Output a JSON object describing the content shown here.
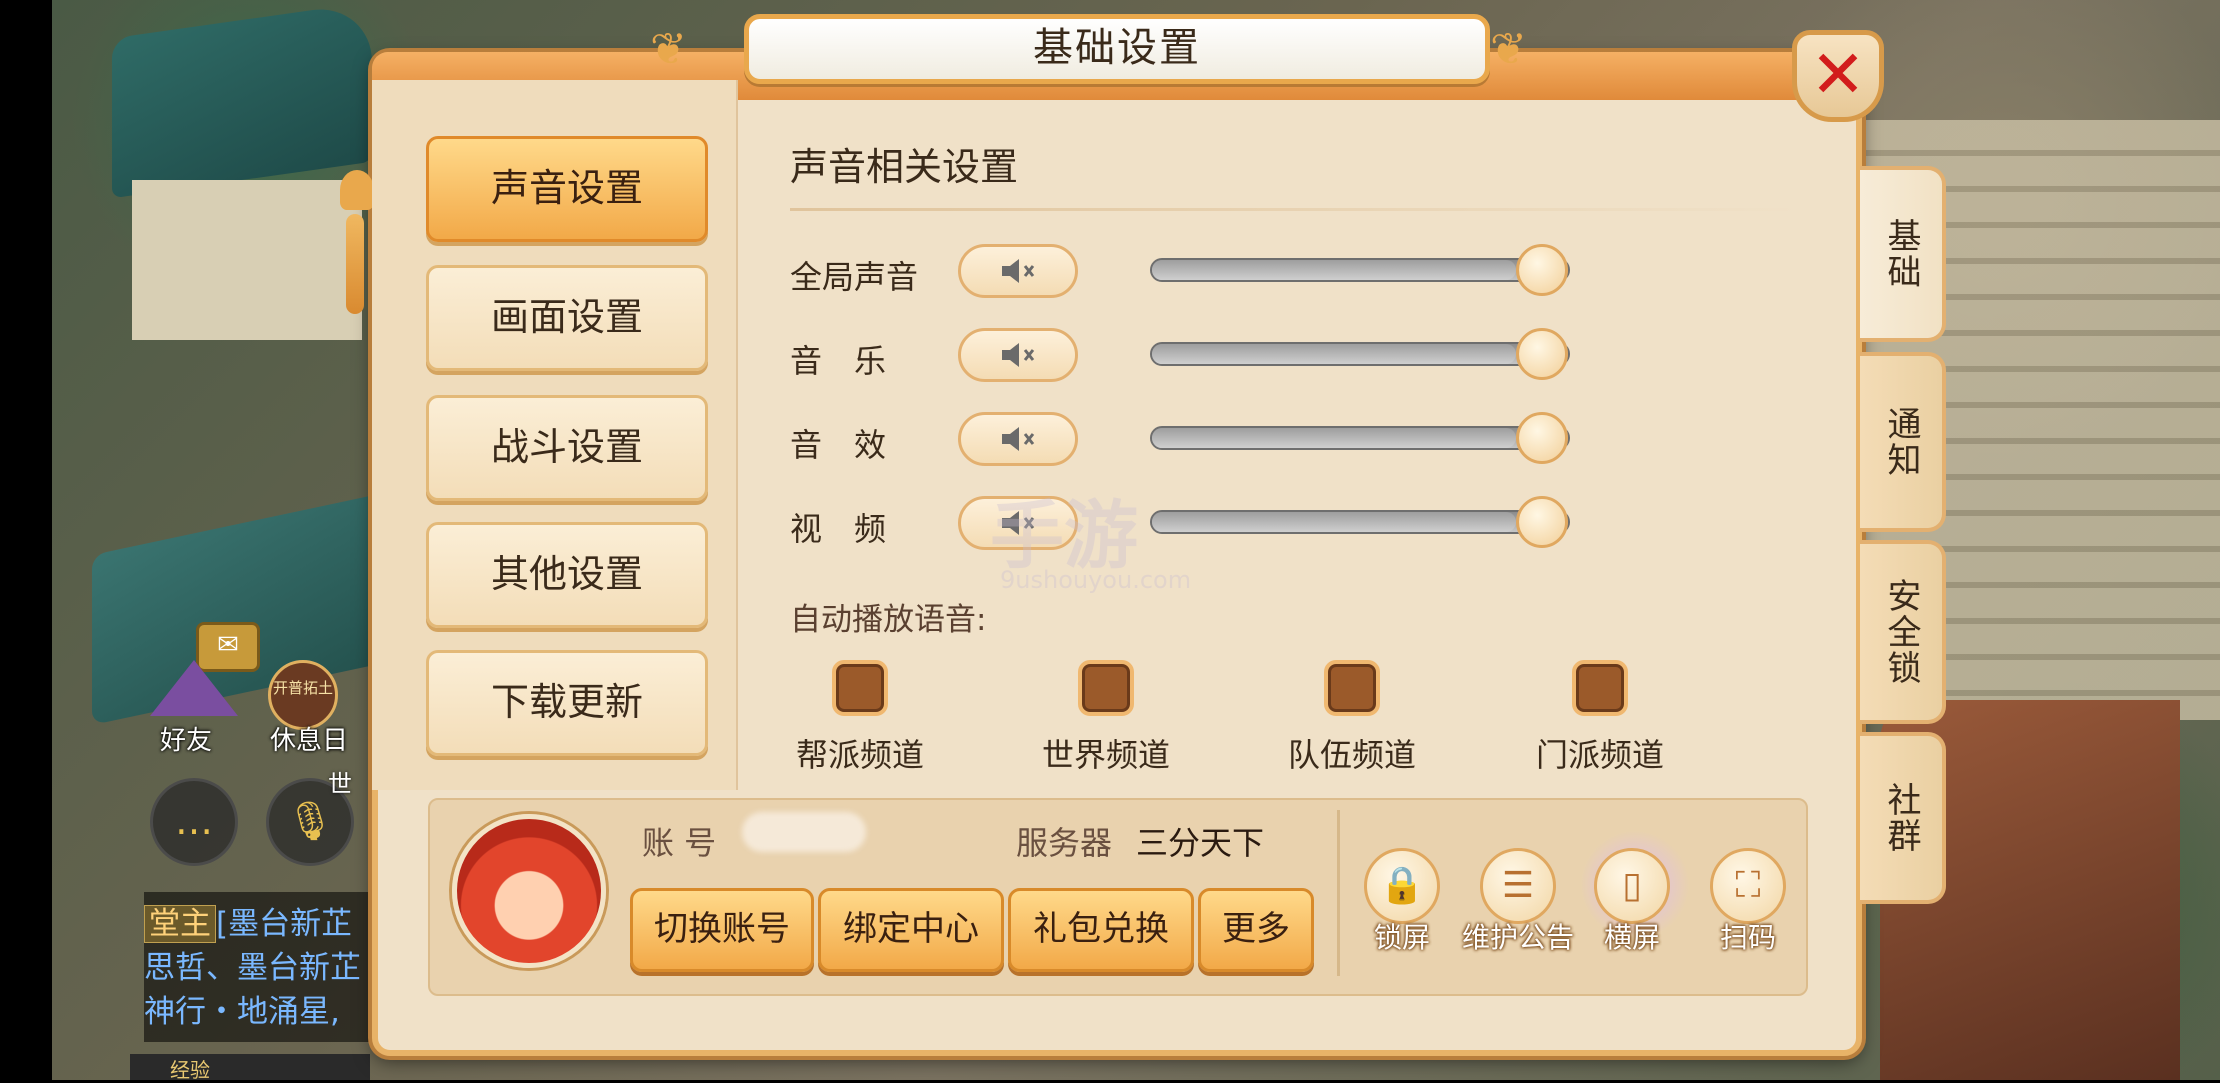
{
  "window": {
    "title": "基础设置",
    "close_icon": "close-icon"
  },
  "categories": [
    {
      "label": "声音设置",
      "active": true
    },
    {
      "label": "画面设置",
      "active": false
    },
    {
      "label": "战斗设置",
      "active": false
    },
    {
      "label": "其他设置",
      "active": false
    },
    {
      "label": "下载更新",
      "active": false
    }
  ],
  "side_tabs": [
    {
      "label": "基础",
      "active": true
    },
    {
      "label": "通知",
      "active": false
    },
    {
      "label": "安全锁",
      "active": false
    },
    {
      "label": "社群",
      "active": false
    }
  ],
  "sound": {
    "section_title": "声音相关设置",
    "controls": [
      {
        "label": "全局声音",
        "level": 1.0
      },
      {
        "label": "音　乐",
        "level": 1.0
      },
      {
        "label": "音　效",
        "level": 1.0
      },
      {
        "label": "视　频",
        "level": 1.0
      }
    ],
    "auto_play_label": "自动播放语音:",
    "channels": [
      "帮派频道",
      "世界频道",
      "队伍频道",
      "门派频道"
    ]
  },
  "account": {
    "account_label": "账 号",
    "server_label": "服务器",
    "server_value": "三分天下",
    "buttons": [
      "切换账号",
      "绑定中心",
      "礼包兑换",
      "更多"
    ],
    "tools": [
      {
        "label": "锁屏",
        "icon": "lock-icon"
      },
      {
        "label": "维护公告",
        "icon": "notice-board-icon"
      },
      {
        "label": "横屏",
        "icon": "rotate-screen-icon"
      },
      {
        "label": "扫码",
        "icon": "scan-icon"
      }
    ]
  },
  "hud": {
    "friend_label": "好友",
    "rest_label": "休息日",
    "badge_text": "开普拓土",
    "world_label": "世",
    "chat": [
      {
        "tag": "堂主",
        "text": "[墨台新芷"
      },
      {
        "text": "思哲、墨台新芷"
      },
      {
        "text": "神行・地涌星,"
      }
    ],
    "exp_label": "经验"
  },
  "watermark": {
    "main": "手游",
    "sub": "9ushouyou.com"
  },
  "colors": {
    "accent": "#f2a948",
    "close": "#d21c1c",
    "checkbox": "#9b5a2a"
  }
}
